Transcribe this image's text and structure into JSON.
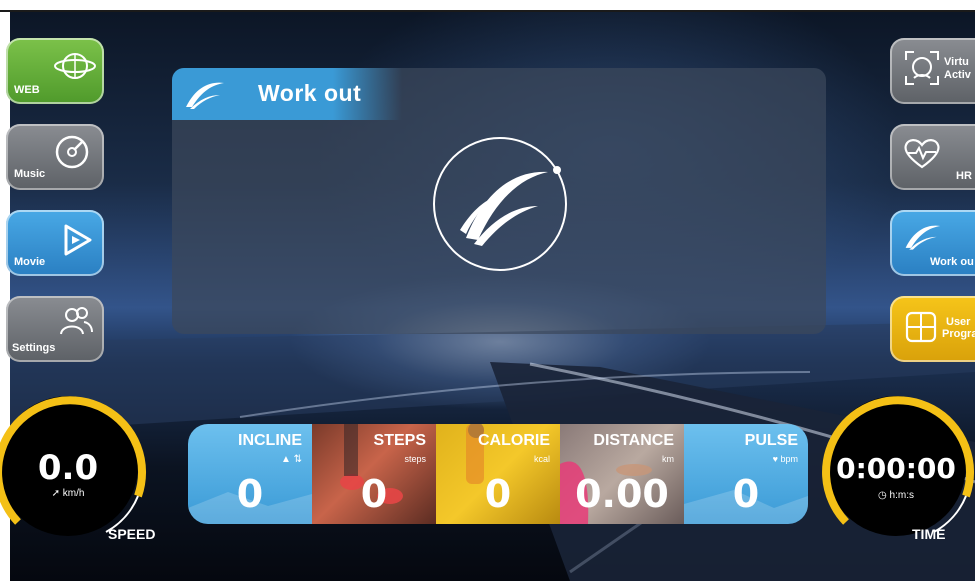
{
  "panel": {
    "title": "Work out"
  },
  "left_buttons": [
    {
      "label": "WEB",
      "icon": "globe-icon"
    },
    {
      "label": "Music",
      "icon": "music-disc-icon"
    },
    {
      "label": "Movie",
      "icon": "play-icon"
    },
    {
      "label": "Settings",
      "icon": "users-icon"
    }
  ],
  "right_buttons": [
    {
      "label_line1": "Virtu",
      "label_line2": "Activ",
      "icon": "virtual-activity-icon"
    },
    {
      "label": "HR",
      "icon": "heart-rate-icon"
    },
    {
      "label": "Work ou",
      "icon": "workout-logo-icon"
    },
    {
      "label_line1": "User",
      "label_line2": "Progra",
      "icon": "user-program-icon"
    }
  ],
  "speed": {
    "value": "0.0",
    "unit": "km/h",
    "caption": "SPEED"
  },
  "time": {
    "value": "0:00:00",
    "unit": "h:m:s",
    "caption": "TIME"
  },
  "stats": [
    {
      "title": "INCLINE",
      "unit": "",
      "value": "0"
    },
    {
      "title": "STEPS",
      "unit": "steps",
      "value": "0"
    },
    {
      "title": "CALORIE",
      "unit": "kcal",
      "value": "0"
    },
    {
      "title": "DISTANCE",
      "unit": "km",
      "value": "0.00"
    },
    {
      "title": "PULSE",
      "unit": "bpm",
      "value": "0"
    }
  ],
  "colors": {
    "accent_blue": "#3a9ad6",
    "green": "#6cb33f",
    "yellow": "#f4c016",
    "grey": "#7a7e84",
    "gauge_ring": "#f4c016"
  }
}
